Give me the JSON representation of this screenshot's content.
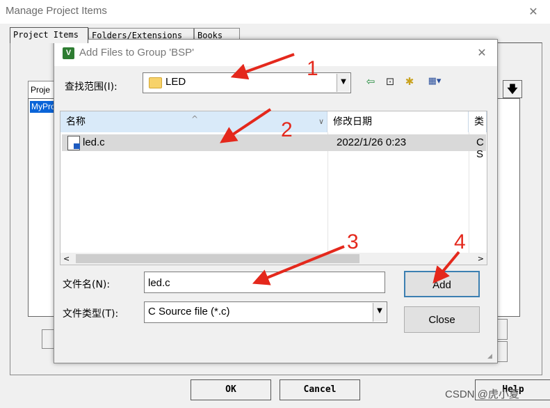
{
  "outer_window": {
    "title": "Manage Project Items",
    "close_glyph": "✕",
    "tabs": [
      "Project Items",
      "Folders/Extensions",
      "Books"
    ],
    "list_header": "Proje",
    "list_selected_item": "MyPro",
    "down_glyph": "🡇",
    "buttons": {
      "ok": "OK",
      "cancel": "Cancel",
      "help": "Help"
    }
  },
  "dialog": {
    "title": "Add Files to Group 'BSP'",
    "app_icon_letter": "V",
    "close_glyph": "✕",
    "look_in_label": "查找范围(I):",
    "look_in_value": "LED",
    "dropdown_glyph": "▼",
    "toolbar_icons": [
      "back-icon",
      "up-folder-icon",
      "new-folder-icon",
      "view-menu-icon"
    ],
    "toolbar_glyphs": [
      "⇦",
      "⊡",
      "✱",
      "▦▾"
    ],
    "columns": {
      "name": "名称",
      "modified": "修改日期",
      "type": "类型"
    },
    "sort_glyph": "^",
    "files": [
      {
        "name": "led.c",
        "modified": "2022/1/26 0:23",
        "type": "C S"
      }
    ],
    "scroll_left_glyph": "<",
    "scroll_right_glyph": ">",
    "file_name_label": "文件名(N):",
    "file_name_value": "led.c",
    "file_type_label": "文件类型(T):",
    "file_type_value": "C Source file (*.c)",
    "add_button": "Add",
    "close_button": "Close"
  },
  "annotations": {
    "numbers": [
      "1",
      "2",
      "3",
      "4"
    ],
    "arrow_color": "#e4281c"
  },
  "watermark": "CSDN @虎小夏"
}
